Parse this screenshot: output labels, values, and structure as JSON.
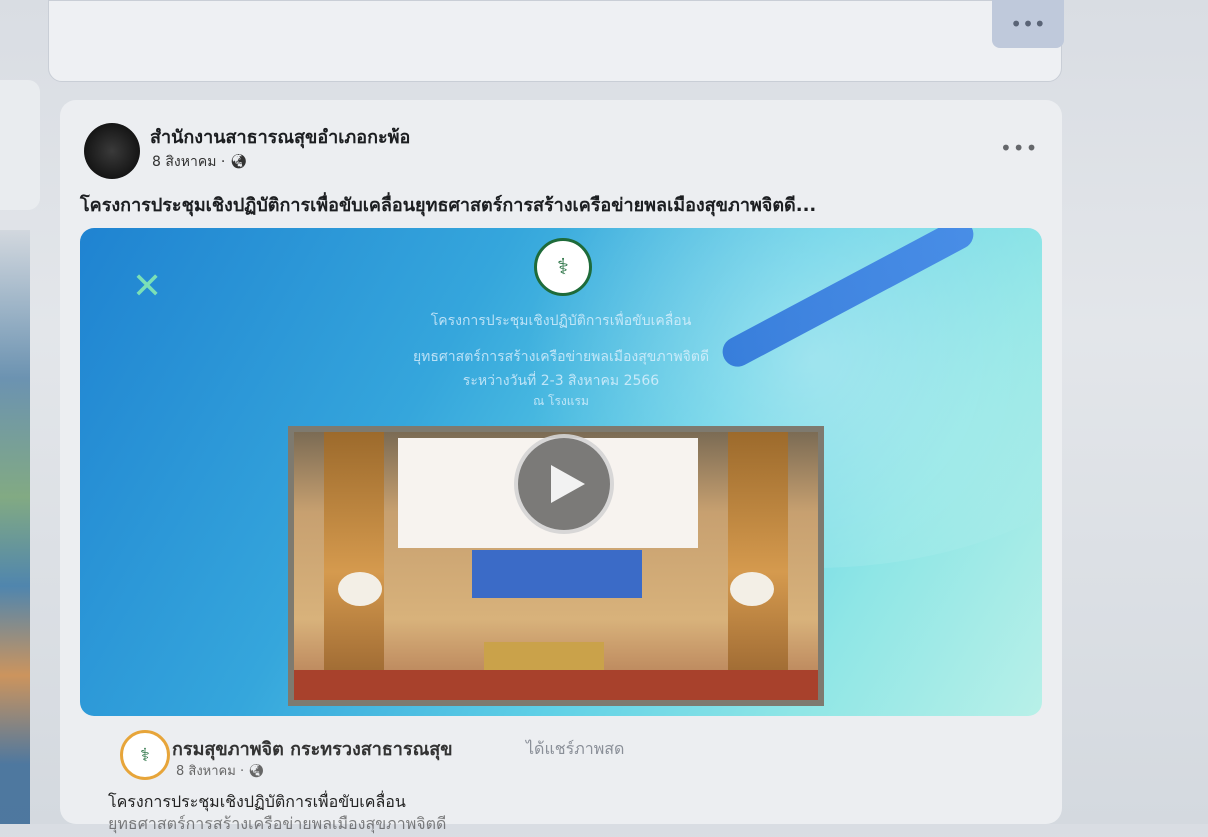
{
  "top_card": {
    "more_label": "•••"
  },
  "post": {
    "page_name": "สำนักงานสาธารณสุขอำเภอกะพ้อ",
    "date": "8 สิงหาคม ·",
    "more_label": "•••",
    "caption": "โครงการประชุมเชิงปฏิบัติการเพื่อขับเคลื่อนยุทธศาสตร์การสร้างเครือข่ายพลเมืองสุขภาพจิตดี...",
    "video": {
      "close_icon": "close-icon",
      "line1": "โครงการประชุมเชิงปฏิบัติการเพื่อขับเคลื่อน",
      "line2": "ยุทธศาสตร์การสร้างเครือข่ายพลเมืองสุขภาพจิตดี",
      "line3": "ระหว่างวันที่ 2-3 สิงหาคม 2566",
      "line4": "ณ โรงแรม",
      "play_icon": "play-icon"
    }
  },
  "shared": {
    "page_name": "กรมสุขภาพจิต กระทรวงสาธารณสุข",
    "action": "ได้แชร์ภาพสด",
    "date": "8 สิงหาคม ·",
    "text_line1": "โครงการประชุมเชิงปฏิบัติการเพื่อขับเคลื่อน",
    "text_line2": "ยุทธศาสตร์การสร้างเครือข่ายพลเมืองสุขภาพจิตดี"
  }
}
